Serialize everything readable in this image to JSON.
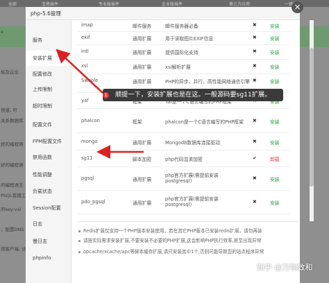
{
  "background": {
    "top_tabs": [
      "全部",
      "宝塔插件",
      "专业版插件",
      "企业版插件",
      "第三方应用",
      "一键部署"
    ],
    "left_snippets": [
      "e",
      "板及企业",
      "快速, 可",
      "关系数据库",
      "好的编程语",
      "好的编程语",
      "的编程语言",
      "PSQL管理工具",
      "的key-val",
      "，配置DNS",
      "部客户端, 访"
    ]
  },
  "modal": {
    "title": "php-5.6管理",
    "close_label": "×",
    "sidebar": [
      {
        "label": "服务"
      },
      {
        "label": "安装扩展"
      },
      {
        "label": "配置修改"
      },
      {
        "label": "上传限制"
      },
      {
        "label": "超时限制"
      },
      {
        "label": "配置文件"
      },
      {
        "label": "FPM配置文件"
      },
      {
        "label": "禁用函数"
      },
      {
        "label": "性能调整"
      },
      {
        "label": "负载状态"
      },
      {
        "label": "Session配置"
      },
      {
        "label": "日志"
      },
      {
        "label": "慢日志"
      },
      {
        "label": "phpinfo"
      }
    ],
    "extensions": [
      {
        "name": "imap",
        "type": "邮件服务",
        "desc": "邮件服务器必备",
        "x": "✖",
        "action": "安装"
      },
      {
        "name": "exif",
        "type": "通用扩展",
        "desc": "用于读取图片EXIF信息",
        "x": "✖",
        "action": "安装"
      },
      {
        "name": "intl",
        "type": "通用扩展",
        "desc": "提供国际化支持",
        "x": "✖",
        "action": "安装"
      },
      {
        "name": "xsl",
        "type": "通用扩展",
        "desc": "xsl解析扩展",
        "x": "✖",
        "action": "安装"
      },
      {
        "name": "Swoole",
        "type": "通用扩展",
        "desc": "PHP的异步、并行、高性能网络通信引擎",
        "x": "✖",
        "action": "安装"
      },
      {
        "name": "yaf",
        "type": "框架",
        "desc": "Yaf是一个C语言编写的PHP框架",
        "x": "✖",
        "action": "安装"
      },
      {
        "name": "phalcon",
        "type": "框架",
        "desc": "phalcon是一个C语言编写的PHP框架",
        "x": "✖",
        "action": "安装"
      },
      {
        "name": "mongo",
        "type": "通用扩展",
        "desc": "Mongodb数据库连接驱动",
        "x": "✖",
        "action": "安装"
      },
      {
        "name": "sg11",
        "type": "脚本加密",
        "desc": "php代码混淆加密",
        "x": "✔",
        "action": "卸载"
      },
      {
        "name": "pgsql",
        "type": "通用扩展",
        "desc": "php官方扩展(需提前安装",
        "desc2": "postgresql)",
        "x": "✖",
        "action": "安装"
      },
      {
        "name": "pdo_pgsql",
        "type": "通用扩展",
        "desc": "php官方扩展(需提前安装",
        "desc2": "postgresql)",
        "x": "✖",
        "action": "安装"
      }
    ],
    "notes": [
      "Redis扩展仅支持一个PHP版本安装使用，若在其它PHP版本已安装redis扩展，请勿再装",
      "请按实际需求安装扩展,不要安装不必要的PHP扩展,这会影响PHP执行效率,甚至出现异常",
      "opcache/xcache/apc等脚本缓存扩展,请只安装其中1个,否则可能导致您的站点程序异常"
    ]
  },
  "annotation": {
    "badge": "1",
    "tooltip": "顺提一下，安装扩展也是在这。一般源码要sg11扩展。",
    "watermark": "知乎 @万物致和"
  },
  "colors": {
    "install": "#20a53a",
    "uninstall": "#e33333",
    "arrow": "#e02020"
  }
}
